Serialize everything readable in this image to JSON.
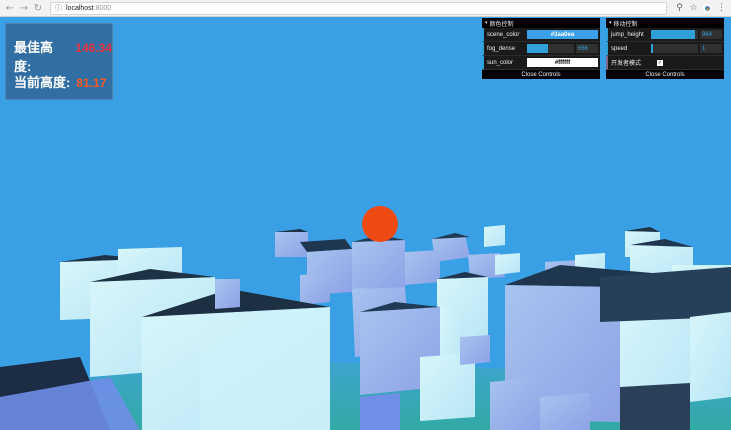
{
  "browser": {
    "back_icon": "back-arrow-icon",
    "forward_icon": "forward-arrow-icon",
    "reload_icon": "reload-icon",
    "url_host": "localhost",
    "url_port": ":8000"
  },
  "scoreboard": {
    "best_label": "最佳高度:",
    "best_value": "146.34",
    "current_label": "当前高度:",
    "current_value": "81.17",
    "best_color": "#e8323c",
    "current_color": "#ff5a1f"
  },
  "color_controls": {
    "title": "颜色控制",
    "scene_color_label": "scene_color",
    "scene_color_value": "#3aa0ea",
    "fog_dense_label": "fog_dense",
    "fog_dense_value": "666",
    "fog_dense_fraction": 0.45,
    "sun_color_label": "sun_color",
    "sun_color_value": "#ffffff",
    "close_label": "Close Controls"
  },
  "move_controls": {
    "title": "移动控制",
    "jump_height_label": "jump_height",
    "jump_height_value": "964",
    "jump_height_fraction": 0.93,
    "speed_label": "speed",
    "speed_value": "1",
    "speed_fraction": 0.05,
    "dev_mode_label": "开发者模式",
    "dev_mode_checked": true,
    "close_label": "Close Controls"
  },
  "scene": {
    "sky_color": "#3aa0e6",
    "ball_color": "#f04a14"
  }
}
